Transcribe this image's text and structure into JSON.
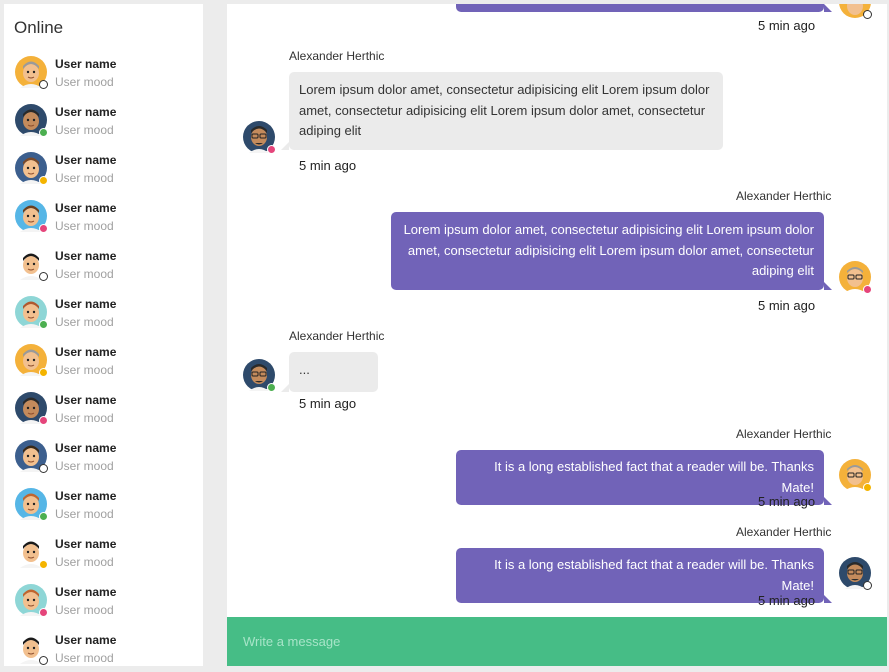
{
  "sidebar": {
    "title": "Online",
    "users": [
      {
        "name": "User name",
        "mood": "User mood",
        "status": "offline",
        "skin": "#f2c08f",
        "hair": "#9a9a9a",
        "bg": "#f4b13a"
      },
      {
        "name": "User name",
        "mood": "User mood",
        "status": "online",
        "skin": "#c48b5c",
        "hair": "#2a2a2a",
        "bg": "#2e4a6b"
      },
      {
        "name": "User name",
        "mood": "User mood",
        "status": "away",
        "skin": "#f2c08f",
        "hair": "#7a4a2a",
        "bg": "#3c5f8e"
      },
      {
        "name": "User name",
        "mood": "User mood",
        "status": "busy",
        "skin": "#f2c08f",
        "hair": "#6a3f1f",
        "bg": "#56b6e6"
      },
      {
        "name": "User name",
        "mood": "User mood",
        "status": "offline",
        "skin": "#f2c08f",
        "hair": "#1a1a1a",
        "bg": "#ffffff"
      },
      {
        "name": "User name",
        "mood": "User mood",
        "status": "online",
        "skin": "#f2c08f",
        "hair": "#b0582e",
        "bg": "#8ed6d6"
      },
      {
        "name": "User name",
        "mood": "User mood",
        "status": "away",
        "skin": "#f2c08f",
        "hair": "#9a9a9a",
        "bg": "#f4b13a"
      },
      {
        "name": "User name",
        "mood": "User mood",
        "status": "busy",
        "skin": "#c48b5c",
        "hair": "#2a2a2a",
        "bg": "#2e4a6b"
      },
      {
        "name": "User name",
        "mood": "User mood",
        "status": "offline",
        "skin": "#f2c08f",
        "hair": "#3a2a1a",
        "bg": "#3c5f8e"
      },
      {
        "name": "User name",
        "mood": "User mood",
        "status": "online",
        "skin": "#f2c08f",
        "hair": "#c0652e",
        "bg": "#56b6e6"
      },
      {
        "name": "User name",
        "mood": "User mood",
        "status": "away",
        "skin": "#f2c08f",
        "hair": "#1a1a1a",
        "bg": "#ffffff"
      },
      {
        "name": "User name",
        "mood": "User mood",
        "status": "busy",
        "skin": "#f2c08f",
        "hair": "#c0652e",
        "bg": "#8ed6d6"
      },
      {
        "name": "User name",
        "mood": "User mood",
        "status": "offline",
        "skin": "#f2c08f",
        "hair": "#1a1a1a",
        "bg": "#ffffff"
      }
    ]
  },
  "chat": {
    "messages": [
      {
        "direction": "out",
        "time": "5 min ago",
        "partial": true
      },
      {
        "direction": "in",
        "author": "Alexander Herthic",
        "text": "Lorem ipsum dolor amet, consectetur adipisicing elit Lorem ipsum dolor amet, consectetur adipisicing elit Lorem ipsum dolor amet, consectetur adiping elit",
        "time": "5 min ago",
        "status": "busy"
      },
      {
        "direction": "out",
        "author": "Alexander Herthic",
        "text": "Lorem ipsum dolor amet, consectetur adipisicing elit Lorem ipsum dolor amet, consectetur adipisicing elit Lorem ipsum dolor amet, consectetur adiping elit",
        "time": "5 min ago",
        "status": "busy"
      },
      {
        "direction": "in",
        "author": "Alexander Herthic",
        "text": "...",
        "time": "5 min ago",
        "status": "online"
      },
      {
        "direction": "out",
        "author": "Alexander Herthic",
        "text": "It is a long established fact that a reader will be. Thanks Mate!",
        "time": "5 min ago",
        "status": "away"
      },
      {
        "direction": "out",
        "author": "Alexander Herthic",
        "text": "It is a long established fact that a reader will be. Thanks Mate!",
        "time": "5 min ago",
        "status": "offline"
      }
    ],
    "composer": {
      "placeholder": "Write a message"
    }
  },
  "colors": {
    "outgoing_bubble": "#7163b8",
    "incoming_bubble": "#ebebeb",
    "composer_bg": "#46bd86",
    "status_online": "#4caf50",
    "status_away": "#f4b400",
    "status_busy": "#e5457b"
  }
}
